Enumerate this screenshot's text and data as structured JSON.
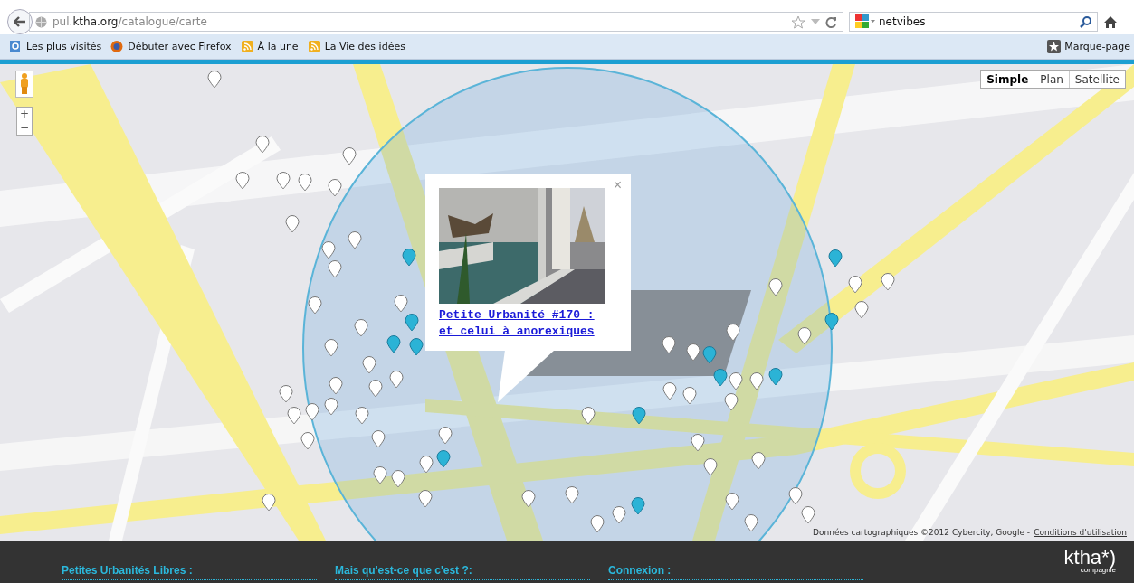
{
  "browser": {
    "url": "pul.**ktha.org**/catalogue/carte",
    "search": {
      "value": "netvibes"
    },
    "bookmarks": [
      {
        "label": "Les plus visités",
        "kind": "search-page"
      },
      {
        "label": "Débuter avec Firefox",
        "kind": "firefox"
      },
      {
        "label": "À la une",
        "kind": "feed"
      },
      {
        "label": "La Vie des idées",
        "kind": "feed"
      }
    ],
    "bookmarks_menu": "Marque-page"
  },
  "map": {
    "zoom": [
      "+",
      "−"
    ],
    "map_types": [
      {
        "label": "Simple",
        "selected": true
      },
      {
        "label": "Plan",
        "selected": false
      },
      {
        "label": "Satellite",
        "selected": false
      }
    ],
    "popup": {
      "close": "×",
      "title": "Petite Urbanité #170 : et celui à anorexiques"
    },
    "attribution": {
      "text": "Données cartographiques ©2012 Cybercity, Google -",
      "link": "Conditions d'utilisation"
    }
  },
  "footer": {
    "headings": [
      "Petites Urbanités Libres :",
      "Mais qu'est-ce que c'est ?:",
      "Connexion :"
    ],
    "logo": {
      "name": "ktha*)",
      "tagline": "compagnie"
    }
  }
}
